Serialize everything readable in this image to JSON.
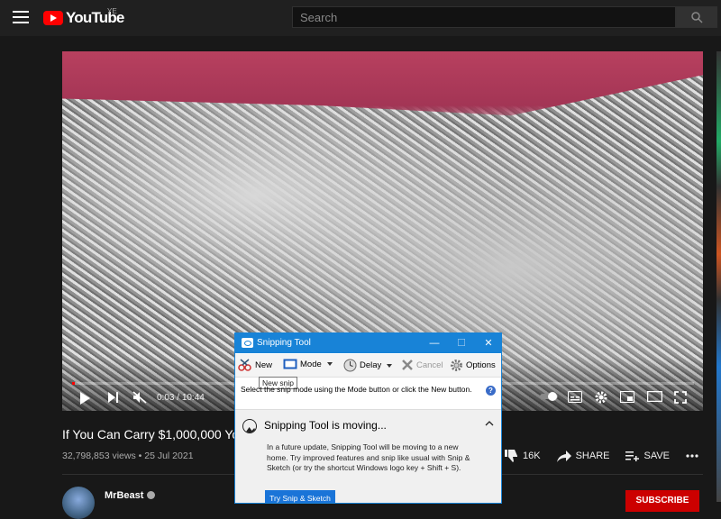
{
  "header": {
    "logo_text": "YouTube",
    "country_code": "YE",
    "search_placeholder": "Search"
  },
  "player": {
    "time_current": "0:03",
    "time_separator": " / ",
    "time_total": "10:44",
    "progress_fraction": 0.005
  },
  "video": {
    "title": "If You Can Carry $1,000,000 You",
    "views": "32,798,853 views",
    "date": "25 Jul 2021",
    "dislike_count": "16K",
    "share_label": "SHARE",
    "save_label": "SAVE"
  },
  "channel": {
    "name": "MrBeast",
    "subscribe_label": "SUBSCRIBE"
  },
  "snipping_tool": {
    "title": "Snipping Tool",
    "minimize": "—",
    "maximize": "☐",
    "close": "✕",
    "new_label": "New",
    "mode_label": "Mode",
    "delay_label": "Delay",
    "cancel_label": "Cancel",
    "options_label": "Options",
    "tooltip": "New snip",
    "instructions": "Select the snip mode using the Mode button or click the New button.",
    "help": "?",
    "notice_title": "Snipping Tool is moving...",
    "notice_body": "In a future update, Snipping Tool will be moving to a new home. Try improved features and snip like usual with Snip & Sketch (or try the shortcut Windows logo key + Shift + S).",
    "try_button": "Try Snip & Sketch"
  },
  "colors": {
    "youtube_red": "#ff0000",
    "windows_blue": "#1883d7",
    "subscribe_red": "#cc0000"
  }
}
